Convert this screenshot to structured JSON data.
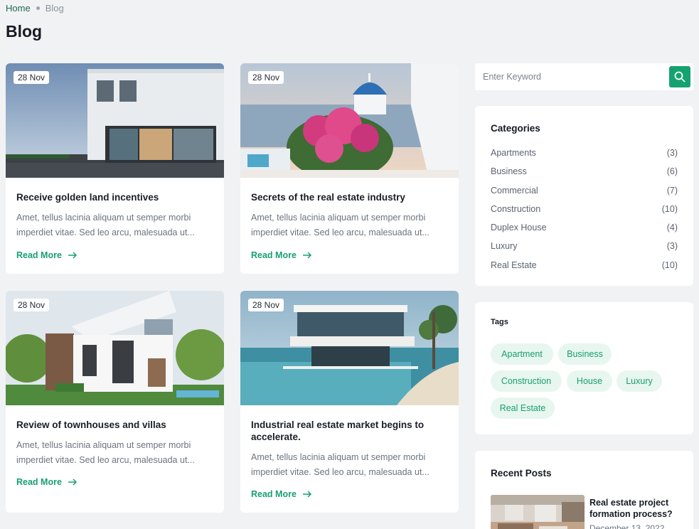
{
  "breadcrumb": {
    "home": "Home",
    "current": "Blog"
  },
  "page_title": "Blog",
  "posts": [
    {
      "date": "28 Nov",
      "title": "Receive golden land incentives",
      "excerpt": "Amet, tellus lacinia aliquam ut semper morbi imperdiet vitae. Sed leo arcu, malesuada ut...",
      "read_more": "Read More"
    },
    {
      "date": "28 Nov",
      "title": "Secrets of the real estate industry",
      "excerpt": "Amet, tellus lacinia aliquam ut semper morbi imperdiet vitae. Sed leo arcu, malesuada ut...",
      "read_more": "Read More"
    },
    {
      "date": "28 Nov",
      "title": "Review of townhouses and villas",
      "excerpt": "Amet, tellus lacinia aliquam ut semper morbi imperdiet vitae. Sed leo arcu, malesuada ut...",
      "read_more": "Read More"
    },
    {
      "date": "28 Nov",
      "title": "Industrial real estate market begins to accelerate.",
      "excerpt": "Amet, tellus lacinia aliquam ut semper morbi imperdiet vitae. Sed leo arcu, malesuada ut...",
      "read_more": "Read More"
    }
  ],
  "search": {
    "placeholder": "Enter Keyword",
    "value": ""
  },
  "categories": {
    "title": "Categories",
    "items": [
      {
        "label": "Apartments",
        "count": "(3)"
      },
      {
        "label": "Business",
        "count": "(6)"
      },
      {
        "label": "Commercial",
        "count": "(7)"
      },
      {
        "label": "Construction",
        "count": "(10)"
      },
      {
        "label": "Duplex House",
        "count": "(4)"
      },
      {
        "label": "Luxury",
        "count": "(3)"
      },
      {
        "label": "Real Estate",
        "count": "(10)"
      }
    ]
  },
  "tags": {
    "title": "Tags",
    "items": [
      "Apartment",
      "Business",
      "Construction",
      "House",
      "Luxury",
      "Real Estate"
    ]
  },
  "recent_posts": {
    "title": "Recent Posts",
    "items": [
      {
        "title": "Real estate project formation process?",
        "date": "December 13, 2022"
      }
    ]
  },
  "colors": {
    "accent": "#15a271",
    "accent_text": "#17a06f",
    "tag_bg": "#e8f6f0",
    "page_bg": "#f1f2f4"
  },
  "icons": {
    "search": "search-icon",
    "arrow": "arrow-right-icon"
  }
}
